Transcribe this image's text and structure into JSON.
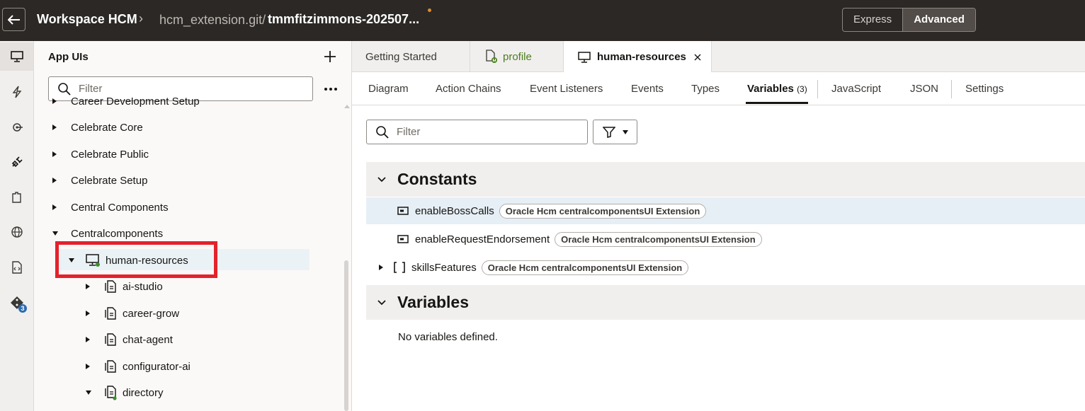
{
  "header": {
    "title": "Workspace HCM",
    "repo": "hcm_extension.git/",
    "branch": "tmmfitzimmons-202507...",
    "modes": [
      "Express",
      "Advanced"
    ],
    "active_mode": "Advanced"
  },
  "rail": {
    "icons": [
      "app-uis-icon",
      "flash-icon",
      "services-icon",
      "plug-icon",
      "business-objects-icon",
      "globe-icon",
      "source-file-icon",
      "git-icon"
    ],
    "git_badge": "3"
  },
  "navigator": {
    "title": "App UIs",
    "filter_placeholder": "Filter",
    "tree": [
      {
        "label": "Career Development Setup",
        "level": 0,
        "state": "collapsed"
      },
      {
        "label": "Celebrate Core",
        "level": 0,
        "state": "collapsed"
      },
      {
        "label": "Celebrate Public",
        "level": 0,
        "state": "collapsed"
      },
      {
        "label": "Celebrate Setup",
        "level": 0,
        "state": "collapsed"
      },
      {
        "label": "Central Components",
        "level": 0,
        "state": "collapsed"
      },
      {
        "label": "Centralcomponents",
        "level": 0,
        "state": "expanded"
      },
      {
        "label": "human-resources",
        "level": 1,
        "state": "expanded",
        "icon": "app-ui-icon"
      },
      {
        "label": "ai-studio",
        "level": 2,
        "state": "collapsed",
        "icon": "flow-icon"
      },
      {
        "label": "career-grow",
        "level": 2,
        "state": "collapsed",
        "icon": "flow-icon"
      },
      {
        "label": "chat-agent",
        "level": 2,
        "state": "collapsed",
        "icon": "flow-icon"
      },
      {
        "label": "configurator-ai",
        "level": 2,
        "state": "collapsed",
        "icon": "flow-icon"
      },
      {
        "label": "directory",
        "level": 2,
        "state": "expanded",
        "icon": "flow-icon"
      }
    ]
  },
  "editor": {
    "file_tabs": [
      {
        "label": "Getting Started"
      },
      {
        "label": "profile"
      },
      {
        "label": "human-resources",
        "active": true
      }
    ],
    "sub_tabs": [
      "Diagram",
      "Action Chains",
      "Event Listeners",
      "Events",
      "Types",
      "Variables",
      "JavaScript",
      "JSON",
      "Settings"
    ],
    "active_sub_tab": "Variables",
    "variables_count": "(3)",
    "filter_placeholder": "Filter",
    "sections": {
      "constants_title": "Constants",
      "variables_title": "Variables",
      "empty_text": "No variables defined."
    },
    "constants": [
      {
        "name": "enableBossCalls",
        "tag": "Oracle Hcm centralcomponentsUI Extension"
      },
      {
        "name": "enableRequestEndorsement",
        "tag": "Oracle Hcm centralcomponentsUI Extension"
      },
      {
        "name": "skillsFeatures",
        "tag": "Oracle Hcm centralcomponentsUI Extension"
      }
    ]
  },
  "colors": {
    "header_bg": "#2b2825",
    "selection": "#e6eff5",
    "highlight_box": "#e4222a",
    "status_dot": "#e08a2d",
    "profile_green": "#4a7e1e"
  }
}
